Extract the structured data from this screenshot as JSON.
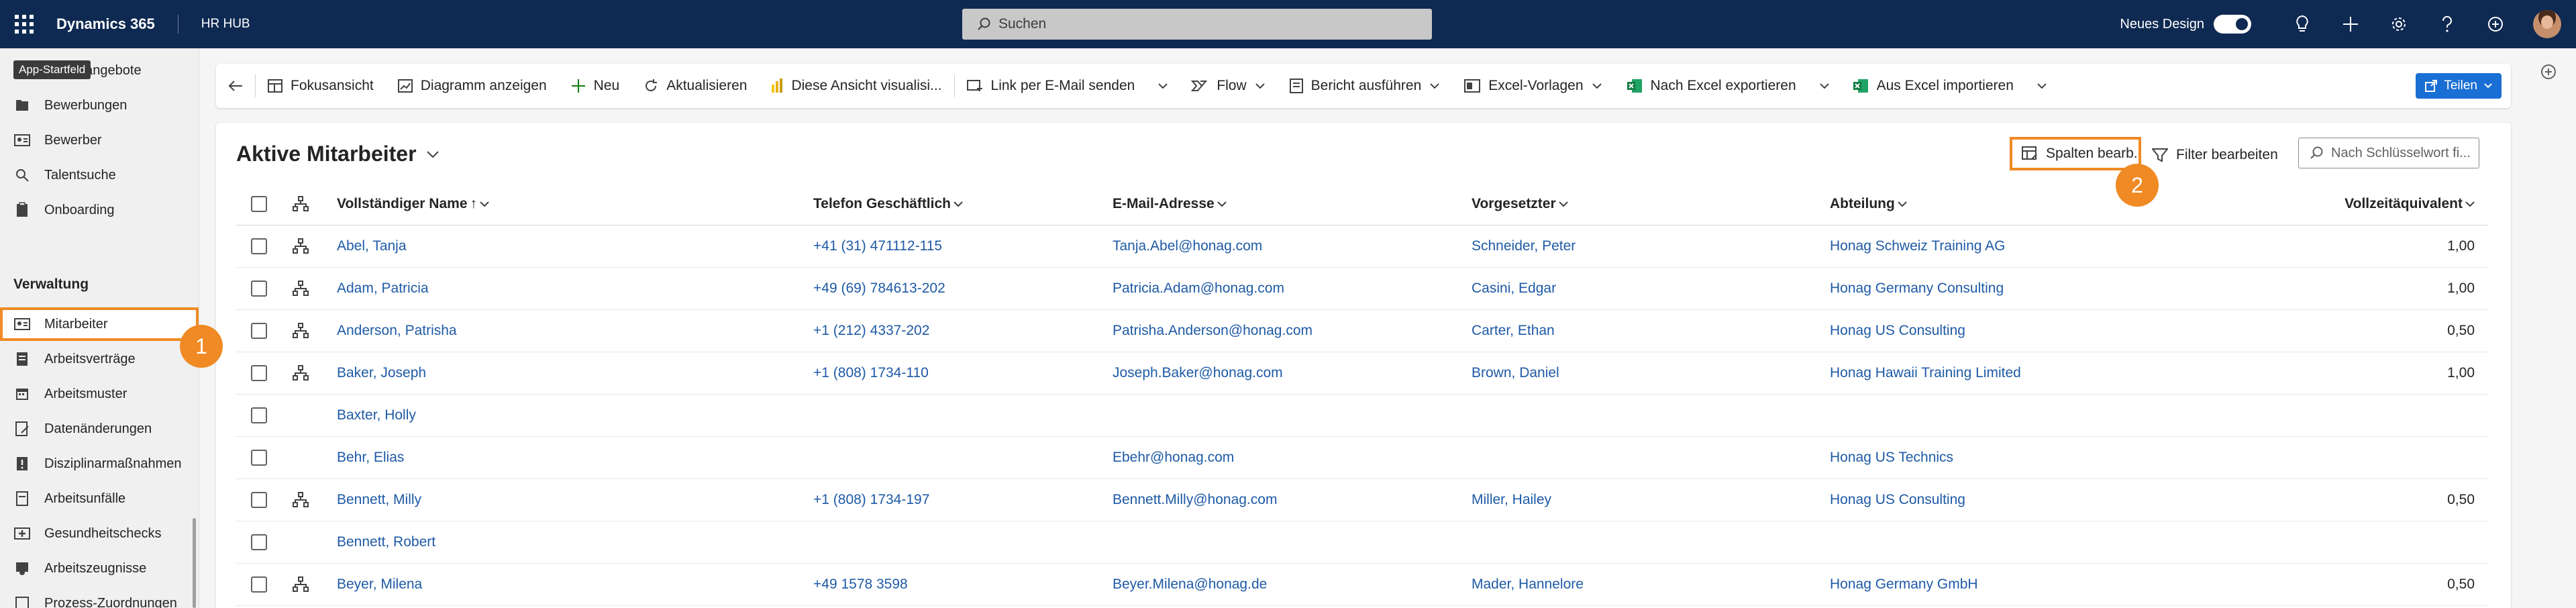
{
  "topbar": {
    "brand": "Dynamics 365",
    "app_name": "HR HUB",
    "search_placeholder": "Suchen",
    "new_design_label": "Neues Design"
  },
  "tooltip": "App-Startfeld",
  "sidebar": {
    "items_top": [
      {
        "label": "Stellenangebote",
        "icon": "document-icon"
      },
      {
        "label": "Bewerbungen",
        "icon": "folder-icon"
      },
      {
        "label": "Bewerber",
        "icon": "contact-card-icon"
      },
      {
        "label": "Talentsuche",
        "icon": "search-icon"
      },
      {
        "label": "Onboarding",
        "icon": "clipboard-icon"
      }
    ],
    "section": "Verwaltung",
    "items_bottom": [
      {
        "label": "Mitarbeiter",
        "icon": "person-card-icon",
        "active": true
      },
      {
        "label": "Arbeitsverträge",
        "icon": "contract-icon"
      },
      {
        "label": "Arbeitsmuster",
        "icon": "calendar-icon"
      },
      {
        "label": "Datenänderungen",
        "icon": "document-edit-icon"
      },
      {
        "label": "Disziplinarmaßnahmen",
        "icon": "warning-icon"
      },
      {
        "label": "Arbeitsunfälle",
        "icon": "document-icon"
      },
      {
        "label": "Gesundheitschecks",
        "icon": "medical-icon"
      },
      {
        "label": "Arbeitszeugnisse",
        "icon": "certificate-icon"
      },
      {
        "label": "Prozess-Zuordnungen",
        "icon": "process-icon"
      }
    ]
  },
  "commandbar": {
    "items": [
      "Fokusansicht",
      "Diagramm anzeigen",
      "Neu",
      "Aktualisieren",
      "Diese Ansicht visualisi...",
      "Link per E-Mail senden",
      "Flow",
      "Bericht ausführen",
      "Excel-Vorlagen",
      "Nach Excel exportieren",
      "Aus Excel importieren"
    ],
    "share_label": "Teilen"
  },
  "view": {
    "title": "Aktive Mitarbeiter",
    "edit_columns": "Spalten bearb.",
    "edit_filters": "Filter bearbeiten",
    "keyword_placeholder": "Nach Schlüsselwort fi..."
  },
  "badges": [
    "1",
    "2"
  ],
  "columns": [
    "Vollständiger Name",
    "Telefon Geschäftlich",
    "E-Mail-Adresse",
    "Vorgesetzter",
    "Abteilung",
    "Vollzeitäquivalent"
  ],
  "rows": [
    {
      "name": "Abel, Tanja",
      "tel": "+41 (31) 471112-115",
      "mail": "Tanja.Abel@honag.com",
      "vor": "Schneider, Peter",
      "abt": "Honag Schweiz Training AG",
      "vza": "1,00",
      "hier": true
    },
    {
      "name": "Adam, Patricia",
      "tel": "+49 (69) 784613-202",
      "mail": "Patricia.Adam@honag.com",
      "vor": "Casini, Edgar",
      "abt": "Honag Germany Consulting",
      "vza": "1,00",
      "hier": true
    },
    {
      "name": "Anderson, Patrisha",
      "tel": "+1 (212) 4337-202",
      "mail": "Patrisha.Anderson@honag.com",
      "vor": "Carter, Ethan",
      "abt": "Honag US Consulting",
      "vza": "0,50",
      "hier": true
    },
    {
      "name": "Baker, Joseph",
      "tel": "+1 (808) 1734-110",
      "mail": "Joseph.Baker@honag.com",
      "vor": "Brown, Daniel",
      "abt": "Honag Hawaii Training Limited",
      "vza": "1,00",
      "hier": true
    },
    {
      "name": "Baxter, Holly",
      "tel": "",
      "mail": "",
      "vor": "",
      "abt": "",
      "vza": "",
      "hier": false
    },
    {
      "name": "Behr, Elias",
      "tel": "",
      "mail": "Ebehr@honag.com",
      "vor": "",
      "abt": "Honag US Technics",
      "vza": "",
      "hier": false
    },
    {
      "name": "Bennett, Milly",
      "tel": "+1 (808) 1734-197",
      "mail": "Bennett.Milly@honag.com",
      "vor": "Miller, Hailey",
      "abt": "Honag US Consulting",
      "vza": "0,50",
      "hier": true
    },
    {
      "name": "Bennett, Robert",
      "tel": "",
      "mail": "",
      "vor": "",
      "abt": "",
      "vza": "",
      "hier": false
    },
    {
      "name": "Beyer, Milena",
      "tel": "+49 1578 3598",
      "mail": "Beyer.Milena@honag.de",
      "vor": "Mader, Hannelore",
      "abt": "Honag Germany GmbH",
      "vza": "0,50",
      "hier": true
    }
  ]
}
